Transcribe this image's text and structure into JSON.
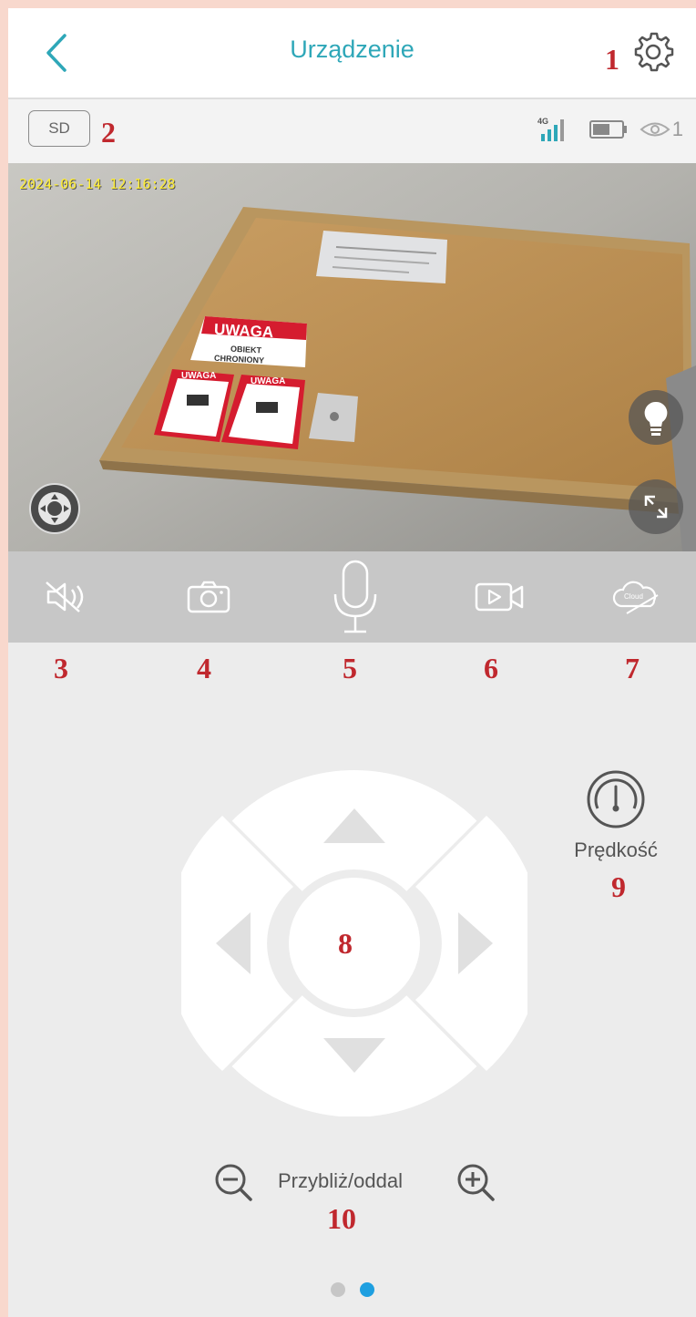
{
  "header": {
    "title": "Urządzenie",
    "back_icon": "chevron-left-icon",
    "settings_icon": "gear-icon"
  },
  "status": {
    "sd_label": "SD",
    "signal_label": "4G",
    "viewer_count": "1"
  },
  "video": {
    "timestamp": "2024-06-14 12:16:28",
    "sign_main_title": "UWAGA",
    "sign_main_line1": "OBIEKT",
    "sign_main_line2": "CHRONIONY",
    "sticker_title": "UWAGA"
  },
  "toolbar": {
    "items": [
      {
        "icon": "speaker-mute-icon"
      },
      {
        "icon": "camera-snapshot-icon"
      },
      {
        "icon": "microphone-icon"
      },
      {
        "icon": "video-record-icon"
      },
      {
        "icon": "cloud-off-icon",
        "label": "Cloud"
      }
    ]
  },
  "controls": {
    "speed_label": "Prędkość",
    "zoom_label": "Przybliż/oddal"
  },
  "annotations": [
    "1",
    "2",
    "3",
    "4",
    "5",
    "6",
    "7",
    "8",
    "9",
    "10"
  ],
  "pagination": {
    "total": 2,
    "active": 2
  },
  "colors": {
    "accent": "#2ea7b8",
    "annotation": "#c0282e",
    "dot_active": "#1e9fe0",
    "dot_inactive": "#c6c6c6"
  }
}
